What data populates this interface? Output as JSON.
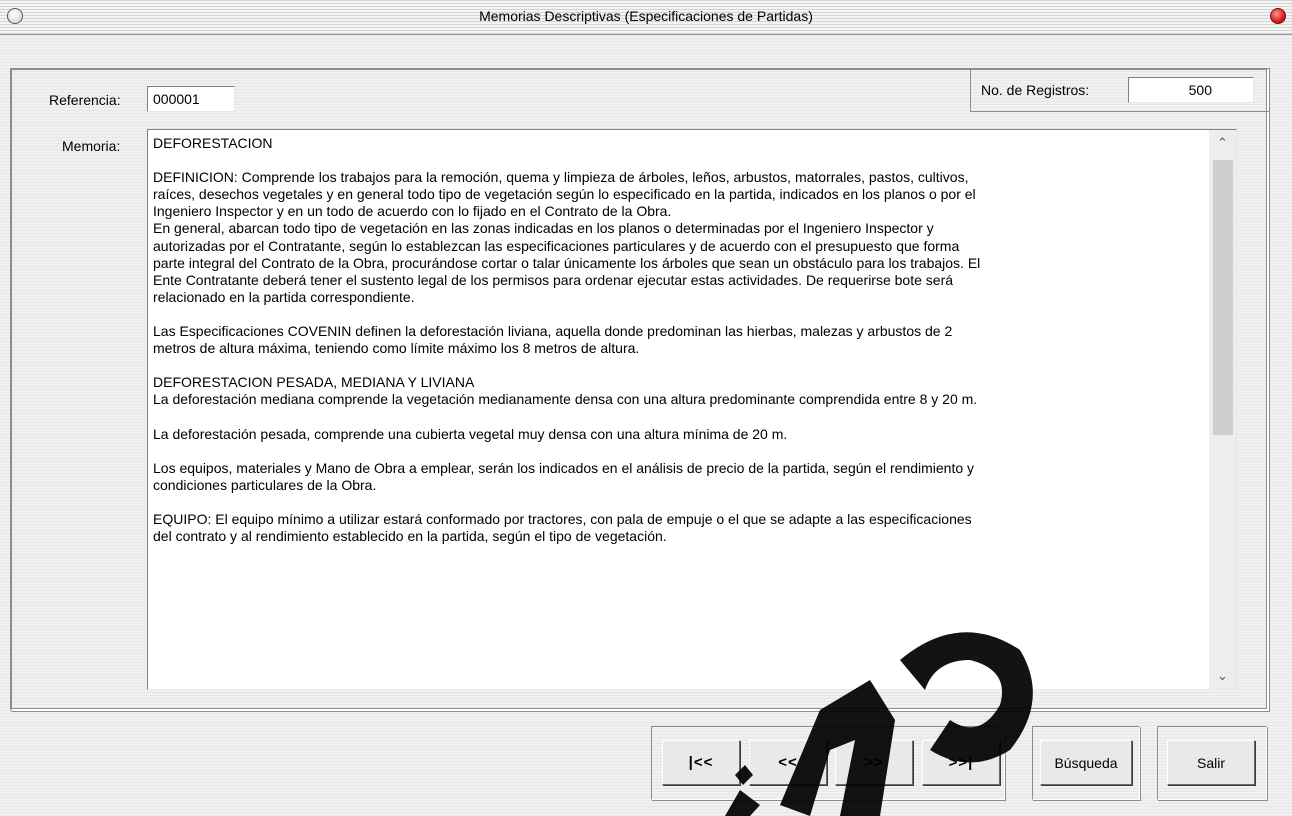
{
  "window": {
    "title": "Memorias Descriptivas (Especificaciones de Partidas)"
  },
  "form": {
    "referencia_label": "Referencia:",
    "referencia_value": "000001",
    "registros_label": "No. de Registros:",
    "registros_value": "500",
    "memoria_label": "Memoria:",
    "memoria_text": "DEFORESTACION\n\nDEFINICION: Comprende los trabajos para la remoción, quema y limpieza de árboles, leños, arbustos, matorrales, pastos, cultivos,\nraíces, desechos vegetales y en general todo tipo de vegetación según lo especificado en la partida, indicados en los planos o por el\nIngeniero Inspector y en un todo de acuerdo con lo fijado en el Contrato de la Obra.\nEn general, abarcan todo tipo de vegetación en las zonas indicadas en los planos o determinadas por el Ingeniero Inspector y\nautorizadas por el Contratante, según lo establezcan las especificaciones particulares y de acuerdo con el presupuesto que forma\nparte integral del Contrato de la Obra, procurándose cortar o talar únicamente los árboles que sean un obstáculo para los trabajos. El\nEnte Contratante deberá tener el sustento legal de los permisos para ordenar ejecutar estas actividades. De requerirse bote será\nrelacionado en la partida correspondiente.\n\nLas Especificaciones COVENIN definen la deforestación liviana, aquella donde predominan las hierbas, malezas y arbustos de 2\nmetros de altura máxima, teniendo como límite máximo los 8 metros de altura.\n\nDEFORESTACION PESADA, MEDIANA Y LIVIANA\nLa deforestación mediana comprende la vegetación medianamente densa con una altura predominante comprendida entre 8 y 20 m.\n\nLa deforestación pesada, comprende una cubierta vegetal muy densa con una altura mínima de 20 m.\n\nLos equipos, materiales y Mano de Obra a emplear, serán los indicados en el análisis de precio de la partida, según el rendimiento y\ncondiciones particulares de la Obra.\n\nEQUIPO: El equipo mínimo a utilizar estará conformado por tractores, con pala de empuje o el que se adapte a las especificaciones\ndel contrato y al rendimiento establecido en la partida, según el tipo de vegetación."
  },
  "nav": {
    "first_label": "|<<",
    "prev_label": "<<",
    "next_label": ">>",
    "last_label": ">>|"
  },
  "actions": {
    "search_label": "Búsqueda",
    "exit_label": "Salir"
  },
  "colors": {
    "close_button": "#d02020",
    "watermark": "#000000"
  },
  "icons": {
    "titlebar_left": "window-menu-circle-icon",
    "titlebar_right": "close-circle-icon",
    "scroll_up": "chevron-up-icon",
    "scroll_down": "chevron-down-icon"
  }
}
